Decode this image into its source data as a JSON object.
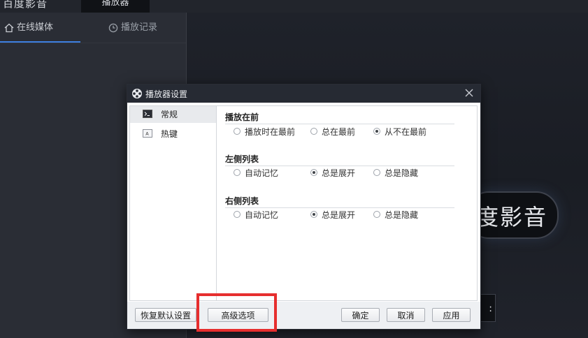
{
  "app": {
    "title": "百度影音",
    "top_tab": "播放器"
  },
  "sidebar": {
    "tabs": [
      {
        "label": "在线媒体",
        "icon": "home-icon"
      },
      {
        "label": "播放记录",
        "icon": "clock-icon"
      }
    ]
  },
  "main": {
    "logo_text": "度影音"
  },
  "dialog": {
    "title": "播放器设置",
    "nav": [
      {
        "label": "常规",
        "icon": "terminal-icon",
        "active": true
      },
      {
        "label": "热键",
        "icon": "keyboard-icon",
        "active": false
      }
    ],
    "sections": [
      {
        "title": "播放在前",
        "options": [
          {
            "label": "播放时在最前",
            "checked": false
          },
          {
            "label": "总在最前",
            "checked": false
          },
          {
            "label": "从不在最前",
            "checked": true
          }
        ]
      },
      {
        "title": "左侧列表",
        "options": [
          {
            "label": "自动记忆",
            "checked": false
          },
          {
            "label": "总是展开",
            "checked": true
          },
          {
            "label": "总是隐藏",
            "checked": false
          }
        ]
      },
      {
        "title": "右侧列表",
        "options": [
          {
            "label": "自动记忆",
            "checked": false
          },
          {
            "label": "总是展开",
            "checked": true
          },
          {
            "label": "总是隐藏",
            "checked": false
          }
        ]
      }
    ],
    "buttons": {
      "restore_defaults": "恢复默认设置",
      "advanced": "高级选项",
      "ok": "确定",
      "cancel": "取消",
      "apply": "应用"
    }
  },
  "colors": {
    "highlight": "#e62e2e",
    "accent": "#3d7fe0"
  }
}
